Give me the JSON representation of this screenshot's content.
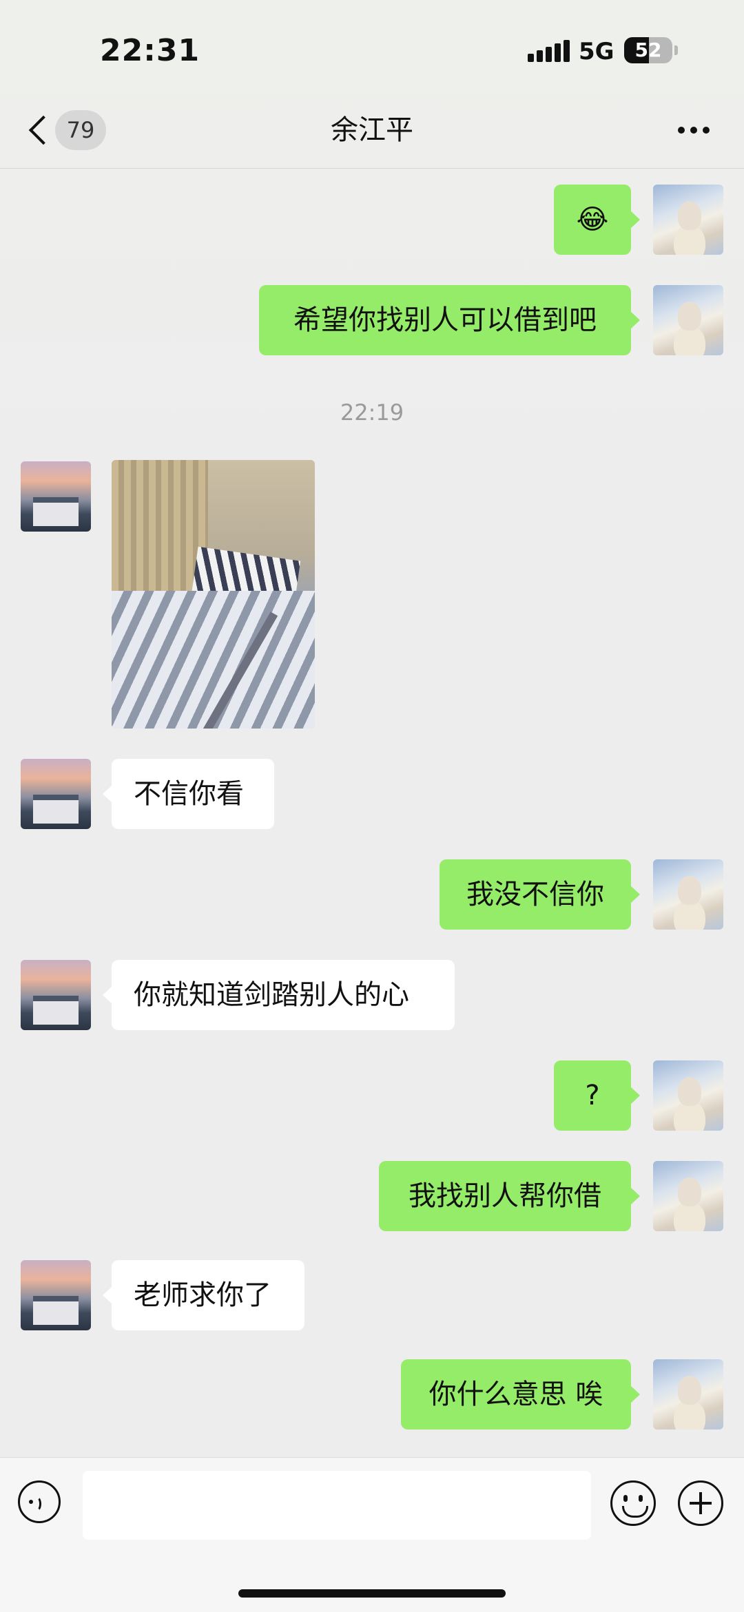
{
  "status_bar": {
    "time": "22:31",
    "network": "5G",
    "battery": "52"
  },
  "nav": {
    "unread_count": "79",
    "title": "余江平"
  },
  "messages": [
    {
      "from": "me",
      "text": "😂"
    },
    {
      "from": "me",
      "text": "希望你找别人可以借到吧"
    },
    {
      "type": "timestamp",
      "text": "22:19"
    },
    {
      "from": "them",
      "type": "photo"
    },
    {
      "from": "them",
      "text": "不信你看"
    },
    {
      "from": "me",
      "text": "我没不信你"
    },
    {
      "from": "them",
      "text": "你就知道剑踏别人的心"
    },
    {
      "from": "me",
      "text": "?"
    },
    {
      "from": "me",
      "text": "我找别人帮你借"
    },
    {
      "from": "them",
      "text": "老师求你了"
    },
    {
      "from": "me",
      "text": "你什么意思 唉"
    }
  ],
  "input": {
    "value": ""
  }
}
